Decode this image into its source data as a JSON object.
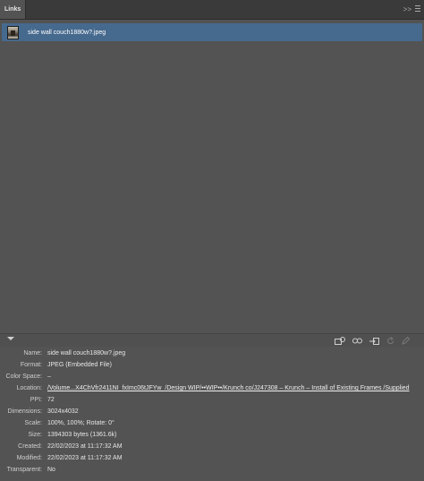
{
  "panel": {
    "tab_label": "Links",
    "expand_icon": ">>",
    "menu_icon": "menu-icon"
  },
  "links_list": {
    "items": [
      {
        "name": "side wall couch1880w?.jpeg",
        "icon": "image-thumbnail"
      }
    ]
  },
  "toolbar": {
    "icons": [
      "relink-from-cc-icon",
      "relink-icon",
      "go-to-link-icon",
      "update-link-icon",
      "edit-original-icon"
    ]
  },
  "link_info": {
    "rows": [
      {
        "label": "Name:",
        "value": "side wall couch1880w?.jpeg"
      },
      {
        "label": "Format:",
        "value": "JPEG (Embedded File)"
      },
      {
        "label": "Color Space:",
        "value": "–"
      },
      {
        "label": "Location:",
        "value": "/Volume...X4ChVfr2411NI_fxImc06tJFYw_/Design WIP/••WIP••/Krunch co/J247308 – Krunch – Install of Existing Frames /Supplied"
      },
      {
        "label": "PPI:",
        "value": "72"
      },
      {
        "label": "Dimensions:",
        "value": "3024x4032"
      },
      {
        "label": "Scale:",
        "value": "100%, 100%; Rotate: 0°"
      },
      {
        "label": "Size:",
        "value": "1394303 bytes (1361.6k)"
      },
      {
        "label": "Created:",
        "value": "22/02/2023 at 11:17:32 AM"
      },
      {
        "label": "Modified:",
        "value": "22/02/2023 at 11:17:32 AM"
      },
      {
        "label": "Transparent:",
        "value": "No"
      }
    ]
  },
  "colors": {
    "panel_bg": "#535353",
    "selection": "#46698e",
    "tab_bar": "#3a3a3a"
  }
}
